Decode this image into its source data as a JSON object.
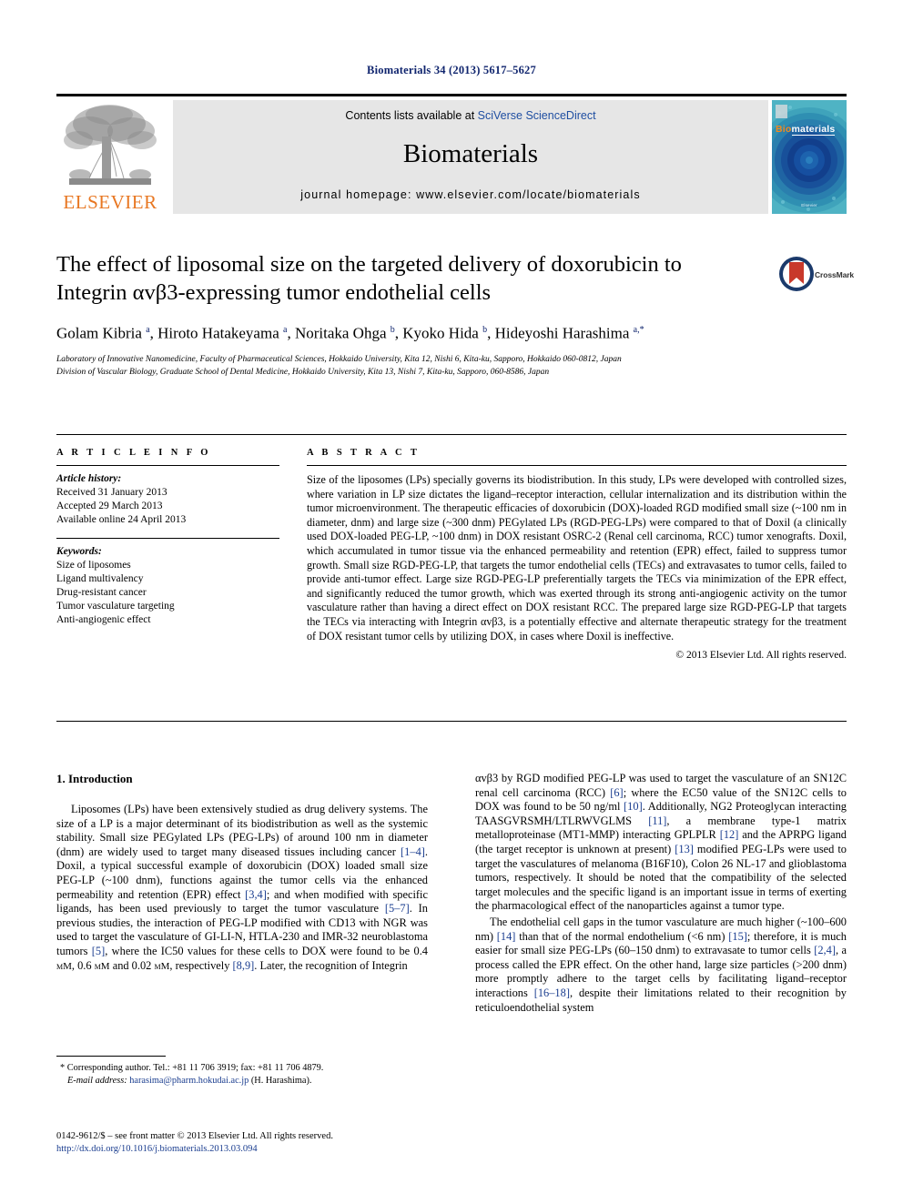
{
  "running_head": "Biomaterials 34 (2013) 5617–5627",
  "masthead": {
    "publisher_name": "ELSEVIER",
    "contents_prefix": "Contents lists available at ",
    "contents_link": "SciVerse ScienceDirect",
    "journal_title": "Biomaterials",
    "homepage": "journal homepage: www.elsevier.com/locate/biomaterials",
    "cover": {
      "title_part1": "Bio",
      "title_part2": "materials",
      "footer": "Elsevier"
    }
  },
  "article": {
    "title": "The effect of liposomal size on the targeted delivery of doxorubicin to Integrin αvβ3-expressing tumor endothelial cells",
    "authors_html": "Golam Kibria <sup>a</sup>, Hiroto Hatakeyama <sup>a</sup>, Noritaka Ohga <sup>b</sup>, Kyoko Hida <sup>b</sup>, Hideyoshi Harashima <sup>a,</sup><sup>*</sup>",
    "affiliation_a": "Laboratory of Innovative Nanomedicine, Faculty of Pharmaceutical Sciences, Hokkaido University, Kita 12, Nishi 6, Kita-ku, Sapporo, Hokkaido 060-0812, Japan",
    "affiliation_b": "Division of Vascular Biology, Graduate School of Dental Medicine, Hokkaido University, Kita 13, Nishi 7, Kita-ku, Sapporo, 060-8586, Japan",
    "crossmark_label": "CrossMark"
  },
  "info": {
    "heading": "A R T I C L E    I N F O",
    "history_label": "Article history:",
    "history": [
      "Received 31 January 2013",
      "Accepted 29 March 2013",
      "Available online 24 April 2013"
    ],
    "keywords_label": "Keywords:",
    "keywords": [
      "Size of liposomes",
      "Ligand multivalency",
      "Drug-resistant cancer",
      "Tumor vasculature targeting",
      "Anti-angiogenic effect"
    ]
  },
  "abstract": {
    "heading": "A B S T R A C T",
    "text": "Size of the liposomes (LPs) specially governs its biodistribution. In this study, LPs were developed with controlled sizes, where variation in LP size dictates the ligand–receptor interaction, cellular internalization and its distribution within the tumor microenvironment. The therapeutic efficacies of doxorubicin (DOX)-loaded RGD modified small size (~100 nm in diameter, dnm) and large size (~300 dnm) PEGylated LPs (RGD-PEG-LPs) were compared to that of Doxil (a clinically used DOX-loaded PEG-LP, ~100 dnm) in DOX resistant OSRC-2 (Renal cell carcinoma, RCC) tumor xenografts. Doxil, which accumulated in tumor tissue via the enhanced permeability and retention (EPR) effect, failed to suppress tumor growth. Small size RGD-PEG-LP, that targets the tumor endothelial cells (TECs) and extravasates to tumor cells, failed to provide anti-tumor effect. Large size RGD-PEG-LP preferentially targets the TECs via minimization of the EPR effect, and significantly reduced the tumor growth, which was exerted through its strong anti-angiogenic activity on the tumor vasculature rather than having a direct effect on DOX resistant RCC. The prepared large size RGD-PEG-LP that targets the TECs via interacting with Integrin αvβ3, is a potentially effective and alternate therapeutic strategy for the treatment of DOX resistant tumor cells by utilizing DOX, in cases where Doxil is ineffective.",
    "copyright": "© 2013 Elsevier Ltd. All rights reserved."
  },
  "body": {
    "section_heading": "1.  Introduction",
    "left_para_1_html": "Liposomes (LPs) have been extensively studied as drug delivery systems. The size of a LP is a major determinant of its biodistribution as well as the systemic stability. Small size PEGylated LPs (PEG-LPs) of around 100 nm in diameter (dnm) are widely used to target many diseased tissues including cancer <span class=\"ref\">[1–4]</span>. Doxil, a typical successful example of doxorubicin (DOX) loaded small size PEG-LP (~100 dnm), functions against the tumor cells via the enhanced permeability and retention (EPR) effect <span class=\"ref\">[3,4]</span>; and when modified with specific ligands, has been used previously to target the tumor vasculature <span class=\"ref\">[5–7]</span>. In previous studies, the interaction of PEG-LP modified with CD13 with NGR was used to target the vasculature of GI-LI-N, HTLA-230 and IMR-32 neuroblastoma tumors <span class=\"ref\">[5]</span>, where the IC50 values for these cells to DOX were found to be 0.4 <span class=\"smallcaps\">μM</span>, 0.6 <span class=\"smallcaps\">μM</span> and 0.02 <span class=\"smallcaps\">μM</span>, respectively <span class=\"ref\">[8,9]</span>. Later, the recognition of Integrin",
    "right_para_1_html": "αvβ3 by RGD modified PEG-LP was used to target the vasculature of an SN12C renal cell carcinoma (RCC) <span class=\"ref\">[6]</span>; where the EC50 value of the SN12C cells to DOX was found to be 50 ng/ml <span class=\"ref\">[10]</span>. Additionally, NG2 Proteoglycan interacting TAASGVRSMH/LTLRWVGLMS <span class=\"ref\">[11]</span>, a membrane type-1 matrix metalloproteinase (MT1-MMP) interacting GPLPLR <span class=\"ref\">[12]</span> and the APRPG ligand (the target receptor is unknown at present) <span class=\"ref\">[13]</span> modified PEG-LPs were used to target the vasculatures of melanoma (B16F10), Colon 26 NL-17 and glioblastoma tumors, respectively. It should be noted that the compatibility of the selected target molecules and the specific ligand is an important issue in terms of exerting the pharmacological effect of the nanoparticles against a tumor type.",
    "right_para_2_html": "The endothelial cell gaps in the tumor vasculature are much higher (~100–600 nm) <span class=\"ref\">[14]</span> than that of the normal endothelium (&lt;6 nm) <span class=\"ref\">[15]</span>; therefore, it is much easier for small size PEG-LPs (60–150 dnm) to extravasate to tumor cells <span class=\"ref\">[2,4]</span>, a process called the EPR effect. On the other hand, large size particles (&gt;200 dnm) more promptly adhere to the target cells by facilitating ligand–receptor interactions <span class=\"ref\">[16–18]</span>, despite their limitations related to their recognition by reticuloendothelial system"
  },
  "footnote": {
    "corresponding_html": "* Corresponding author. Tel.: +81 11 706 3919; fax: +81 11 706 4879.",
    "email_html": "<span class=\"ital\">E-mail address:</span> <span class=\"mail\">harasima@pharm.hokudai.ac.jp</span> (H. Harashima)."
  },
  "page_footer": {
    "front_matter": "0142-9612/$ – see front matter © 2013 Elsevier Ltd. All rights reserved.",
    "doi": "http://dx.doi.org/10.1016/j.biomaterials.2013.03.094"
  }
}
